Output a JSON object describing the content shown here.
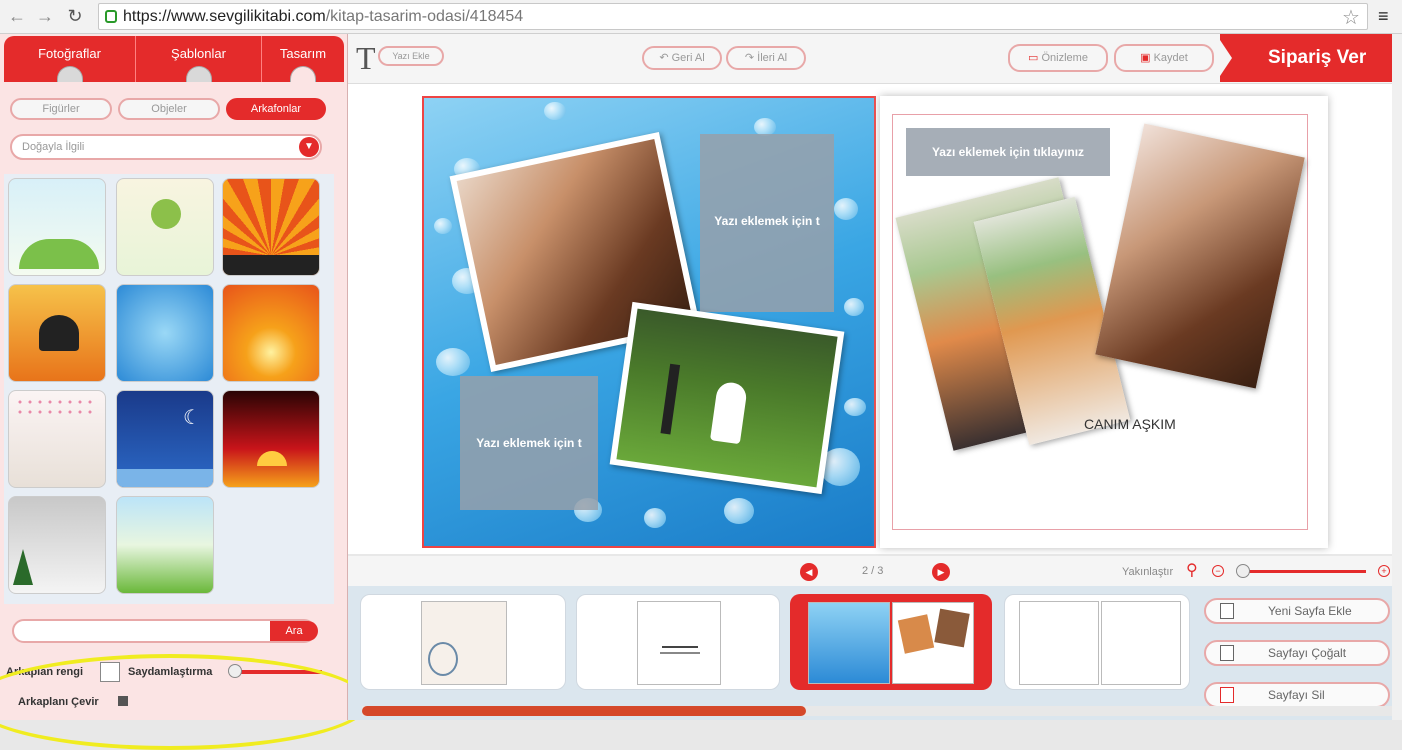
{
  "browser": {
    "url_domain": "https://www.sevgilikitabi.com",
    "url_path": "/kitap-tasarim-odasi/418454"
  },
  "left_tabs": [
    "Fotoğraflar",
    "Şablonlar",
    "Tasarım"
  ],
  "sub_tabs": [
    "Figürler",
    "Objeler",
    "Arkafonlar"
  ],
  "category_select": "Doğayla İlgili",
  "search_button": "Ara",
  "bg_color_label": "Arkaplan rengi",
  "transparency_label": "Saydamlaştırma",
  "flip_label": "Arkaplanı Çevir",
  "toolbar": {
    "add_text": "Yazı Ekle",
    "undo": "Geri Al",
    "redo": "İleri Al",
    "preview": "Önizleme",
    "save": "Kaydet",
    "order": "Sipariş Ver"
  },
  "left_page": {
    "text_placeholder_1": "Yazı eklemek için t",
    "text_placeholder_2": "Yazı eklemek için t"
  },
  "right_page": {
    "text_placeholder": "Yazı eklemek için tıklayınız",
    "caption": "CANIM AŞKIM"
  },
  "page_indicator": "2 / 3",
  "zoom_label": "Yakınlaştır",
  "strip_buttons": {
    "add_page": "Yeni Sayfa Ekle",
    "duplicate_page": "Sayfayı Çoğalt",
    "delete_page": "Sayfayı Sil"
  },
  "colors": {
    "accent": "#e42b2b",
    "highlight": "#f0ec20"
  }
}
